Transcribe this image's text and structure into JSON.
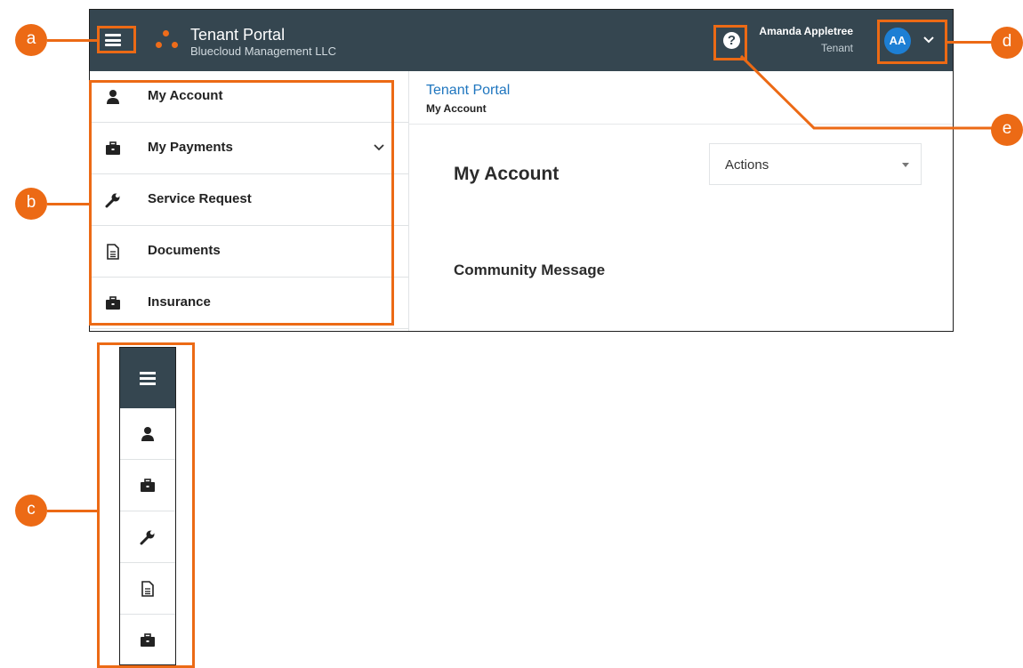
{
  "header": {
    "title": "Tenant Portal",
    "subtitle": "Bluecloud Management LLC",
    "user_name": "Amanda Appletree",
    "user_role": "Tenant",
    "avatar_initials": "AA",
    "help_glyph": "?"
  },
  "sidebar": {
    "items": [
      {
        "label": "My Account",
        "icon": "user-icon"
      },
      {
        "label": "My Payments",
        "icon": "briefcase-icon",
        "expandable": true
      },
      {
        "label": "Service Request",
        "icon": "wrench-icon"
      },
      {
        "label": "Documents",
        "icon": "document-icon"
      },
      {
        "label": "Insurance",
        "icon": "briefcase-icon"
      }
    ]
  },
  "breadcrumb": {
    "app": "Tenant Portal",
    "page": "My Account"
  },
  "main": {
    "page_title": "My Account",
    "actions_label": "Actions",
    "section_title": "Community Message"
  },
  "callouts": [
    "a",
    "b",
    "c",
    "d",
    "e"
  ],
  "colors": {
    "topbar": "#354650",
    "accent_orange": "#ec6a15",
    "link_blue": "#1f76bf",
    "avatar_blue": "#1d7fd4"
  }
}
